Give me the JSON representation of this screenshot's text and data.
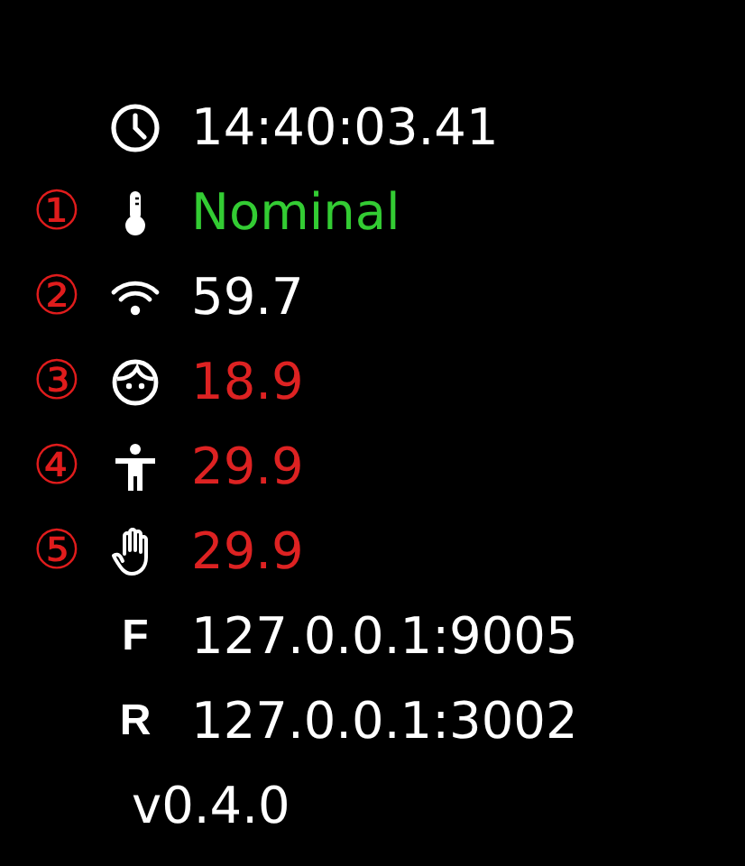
{
  "rows": [
    {
      "kind": "clock",
      "value": "14:40:03.41",
      "color": "#ffffff"
    },
    {
      "marker": "①",
      "kind": "thermometer",
      "value": "Nominal",
      "color": "#33cc33"
    },
    {
      "marker": "②",
      "kind": "wifi",
      "value": "59.7",
      "color": "#ffffff"
    },
    {
      "marker": "③",
      "kind": "face",
      "value": "18.9",
      "color": "#dd2222"
    },
    {
      "marker": "④",
      "kind": "body",
      "value": "29.9",
      "color": "#dd2222"
    },
    {
      "marker": "⑤",
      "kind": "hand",
      "value": "29.9",
      "color": "#dd2222"
    },
    {
      "kind": "letter",
      "letter": "F",
      "value": "127.0.0.1:9005",
      "color": "#ffffff"
    },
    {
      "kind": "letter",
      "letter": "R",
      "value": "127.0.0.1:3002",
      "color": "#ffffff"
    }
  ],
  "version": "v0.4.0"
}
